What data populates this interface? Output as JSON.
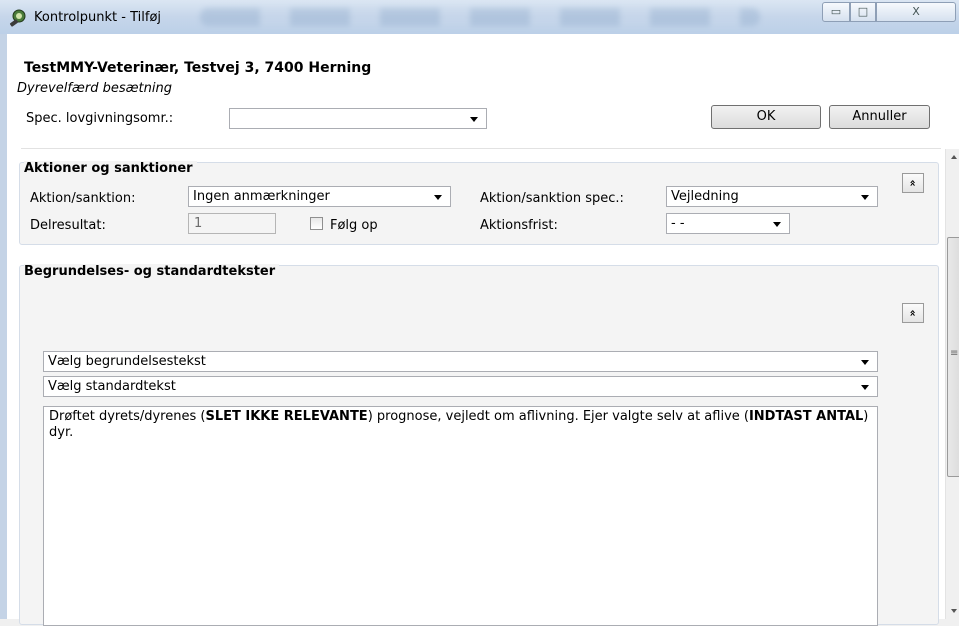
{
  "window": {
    "title": "Kontrolpunkt - Tilføj",
    "minimize_glyph": "▭",
    "maximize_glyph": "□",
    "close_glyph": "X"
  },
  "header": {
    "title": "TestMMY-Veterinær, Testvej 3, 7400 Herning",
    "subtitle": "Dyrevelfærd besætning",
    "spec_label": "Spec. lovgivningsomr.:",
    "spec_value": "",
    "ok_label": "OK",
    "cancel_label": "Annuller"
  },
  "actions_group": {
    "title": "Aktioner og sanktioner",
    "action_label": "Aktion/sanktion:",
    "action_value": "Ingen anmærkninger",
    "action_spec_label": "Aktion/sanktion spec.:",
    "action_spec_value": "Vejledning",
    "delresultat_label": "Delresultat:",
    "delresultat_value": "1",
    "follow_up_label": "Følg op",
    "follow_up_checked": false,
    "deadline_label": "Aktionsfrist:",
    "deadline_value": "- -",
    "collapse_glyph": "«"
  },
  "texts_group": {
    "title": "Begrundelses- og standardtekster",
    "reason_placeholder": "Vælg begrundelsestekst",
    "standard_placeholder": "Vælg standardtekst",
    "collapse_glyph": "«",
    "body": {
      "p1": "Drøftet  dyrets/dyrenes (",
      "b1": "SLET IKKE RELEVANTE",
      "p2": ") prognose, vejledt om aflivning. Ejer valgte selv at aflive (",
      "b2": "INDTAST ANTAL",
      "p3": ") dyr."
    }
  },
  "scrollbar": {
    "grip": "≡"
  },
  "colors": {
    "titlebar": "#c6d6ea",
    "group_bg": "#f4f4f4",
    "border": "#abadb3"
  }
}
